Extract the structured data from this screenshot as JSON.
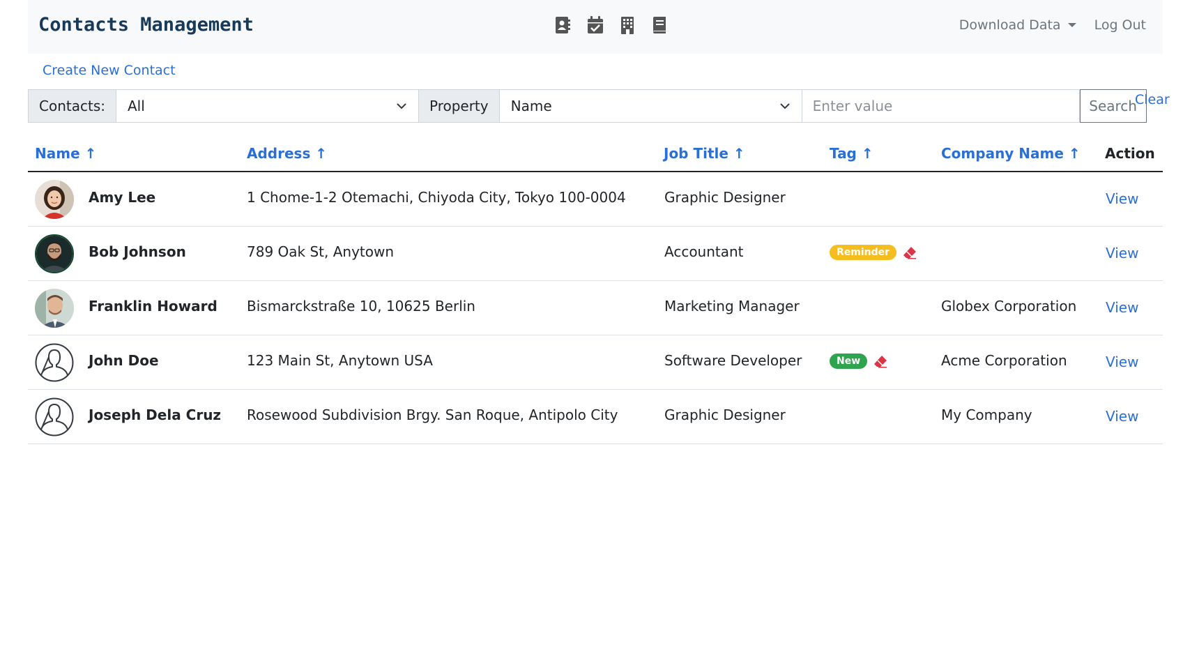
{
  "navbar": {
    "brand": "Contacts Management",
    "icons": [
      "contact-card-icon",
      "calendar-check-icon",
      "building-icon",
      "book-icon"
    ],
    "download_label": "Download Data",
    "logout_label": "Log Out"
  },
  "create_link": "Create New Contact",
  "filter": {
    "contacts_label": "Contacts:",
    "contacts_value": "All",
    "property_label": "Property",
    "property_value": "Name",
    "value_placeholder": "Enter value",
    "search_label": "Search",
    "clear_label": "Clear"
  },
  "table": {
    "headers": {
      "name": "Name ↑",
      "address": "Address ↑",
      "job_title": "Job Title ↑",
      "tag": "Tag ↑",
      "company": "Company Name ↑",
      "action": "Action"
    },
    "rows": [
      {
        "name": "Amy Lee",
        "address": "1 Chome-1-2 Otemachi, Chiyoda City, Tokyo 100-0004",
        "job_title": "Graphic Designer",
        "tag": "",
        "company": "",
        "action": "View",
        "avatar": "photo-woman"
      },
      {
        "name": "Bob Johnson",
        "address": "789 Oak St, Anytown",
        "job_title": "Accountant",
        "tag": "Reminder",
        "company": "",
        "action": "View",
        "avatar": "photo-man-beard"
      },
      {
        "name": "Franklin Howard",
        "address": "Bismarckstraße 10, 10625 Berlin",
        "job_title": "Marketing Manager",
        "tag": "",
        "company": "Globex Corporation",
        "action": "View",
        "avatar": "photo-man"
      },
      {
        "name": "John Doe",
        "address": "123 Main St, Anytown USA",
        "job_title": "Software Developer",
        "tag": "New",
        "company": "Acme Corporation",
        "action": "View",
        "avatar": "default-user-icon"
      },
      {
        "name": "Joseph Dela Cruz",
        "address": "Rosewood Subdivision Brgy. San Roque, Antipolo City",
        "job_title": "Graphic Designer",
        "tag": "",
        "company": "My Company",
        "action": "View",
        "avatar": "default-user-icon"
      }
    ]
  },
  "colors": {
    "link": "#2a6fd6",
    "brand": "#173a5a",
    "badge_reminder": "#f5bd1d",
    "badge_new": "#2ea44f",
    "eraser": "#dc3545"
  }
}
